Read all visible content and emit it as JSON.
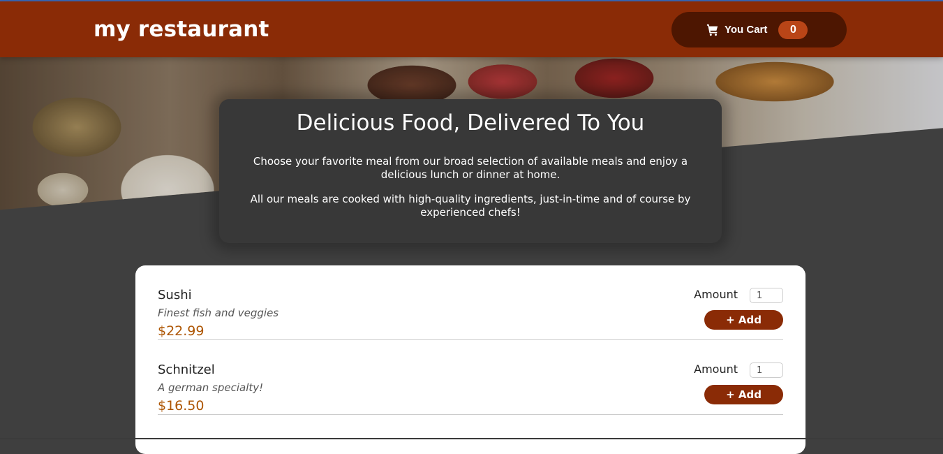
{
  "header": {
    "brand": "my restaurant",
    "cart_label": "You Cart",
    "cart_count": "0"
  },
  "summary": {
    "title": "Delicious Food, Delivered To You",
    "paragraph1": "Choose your favorite meal from our broad selection of available meals and enjoy a delicious lunch or dinner at home.",
    "paragraph2": "All our meals are cooked with high-quality ingredients, just-in-time and of course by experienced chefs!"
  },
  "meals": [
    {
      "name": "Sushi",
      "description": "Finest fish and veggies",
      "price": "$22.99",
      "amount_label": "Amount",
      "amount_value": "1",
      "add_label": "+ Add"
    },
    {
      "name": "Schnitzel",
      "description": "A german specialty!",
      "price": "$16.50",
      "amount_label": "Amount",
      "amount_value": "1",
      "add_label": "+ Add"
    }
  ],
  "colors": {
    "header": "#8a2b06",
    "cart_button": "#4d1601",
    "badge": "#b94517",
    "price": "#ad5502",
    "background": "#3f3f3f"
  },
  "icons": {
    "cart": "shopping-cart-icon"
  }
}
